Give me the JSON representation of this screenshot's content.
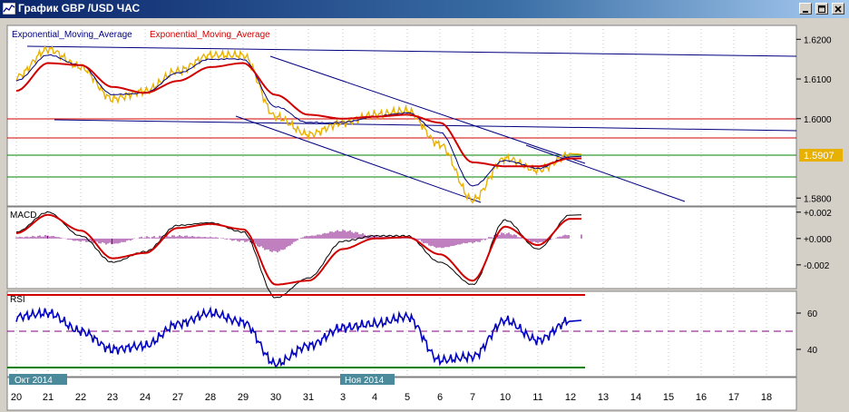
{
  "window": {
    "title": "График GBP /USD ЧАС",
    "buttons": [
      "minimize",
      "maximize",
      "close"
    ]
  },
  "colors": {
    "price": "#e8b000",
    "ema_fast": "#000080",
    "ema_slow": "#d00000",
    "resistance": "#d00000",
    "support": "#008000",
    "channel": "#000080",
    "macd_line": "#000000",
    "macd_signal": "#d00000",
    "macd_hist": "#800080",
    "rsi": "#0000c0",
    "rsi_upper": "#d00000",
    "rsi_lower": "#008000",
    "rsi_mid": "#800080",
    "grid": "#b0b0b0",
    "price_tag": "#e8b000"
  },
  "main_panel": {
    "legend_1": "Exponential_Moving_Average",
    "legend_2": "Exponential_Moving_Average",
    "y_ticks": [
      "1.6200",
      "1.6100",
      "1.6000",
      "1.5800"
    ],
    "last_price": "1.5907"
  },
  "macd_panel": {
    "label": "MACD",
    "y_ticks": [
      "+0.002",
      "+0.000",
      "-0.002"
    ]
  },
  "rsi_panel": {
    "label": "RSI",
    "y_ticks": [
      "60",
      "40"
    ]
  },
  "x_axis": {
    "month_labels": [
      "Окт 2014",
      "Ноя 2014"
    ],
    "ticks": [
      "20",
      "21",
      "22",
      "23",
      "24",
      "27",
      "28",
      "29",
      "30",
      "31",
      "3",
      "4",
      "5",
      "6",
      "7",
      "10",
      "11",
      "12",
      "13",
      "14",
      "15",
      "16",
      "17",
      "18"
    ]
  },
  "chart_data": [
    {
      "type": "line",
      "title": "",
      "x": [
        "20",
        "21",
        "22",
        "23",
        "24",
        "27",
        "28",
        "29",
        "30",
        "31",
        "3",
        "4",
        "5",
        "6",
        "7",
        "10",
        "11",
        "12"
      ],
      "series": [
        {
          "name": "Exponential_Moving_Average",
          "values": [
            1.6095,
            1.616,
            1.6135,
            1.606,
            1.6065,
            1.6115,
            1.615,
            1.615,
            1.603,
            1.599,
            1.599,
            1.6005,
            1.6015,
            1.5965,
            1.583,
            1.5895,
            1.5875,
            1.5905
          ]
        },
        {
          "name": "Exponential_Moving_Average",
          "values": [
            1.607,
            1.614,
            1.6135,
            1.608,
            1.6065,
            1.6095,
            1.613,
            1.614,
            1.606,
            1.601,
            1.6,
            1.6005,
            1.601,
            1.599,
            1.589,
            1.588,
            1.588,
            1.59
          ]
        },
        {
          "values": [
            1.6105,
            1.6175,
            1.613,
            1.605,
            1.607,
            1.612,
            1.616,
            1.616,
            1.6005,
            1.596,
            1.599,
            1.601,
            1.602,
            1.5935,
            1.5795,
            1.59,
            1.587,
            1.591
          ]
        }
      ],
      "ylim": [
        1.578,
        1.6235
      ]
    },
    {
      "type": "line",
      "title": "MACD",
      "x": [
        "20",
        "21",
        "22",
        "23",
        "24",
        "27",
        "28",
        "29",
        "30",
        "31",
        "3",
        "4",
        "5",
        "6",
        "7",
        "10",
        "11",
        "12"
      ],
      "series": [
        {
          "values": [
            0.0005,
            0.002,
            0.0002,
            -0.0018,
            -0.001,
            0.001,
            0.0012,
            0.0005,
            -0.0045,
            -0.003,
            -0.0002,
            0.0002,
            0.0002,
            -0.0018,
            -0.0035,
            0.0014,
            -0.0008,
            0.0018
          ]
        },
        {
          "values": [
            0.0004,
            0.0018,
            0.0006,
            -0.0015,
            -0.0011,
            0.0008,
            0.0011,
            0.0007,
            -0.0035,
            -0.0032,
            -0.0008,
            0.0,
            0.0001,
            -0.0012,
            -0.0032,
            0.0009,
            -0.0005,
            0.0015
          ]
        }
      ],
      "hist": [
        0.0001,
        0.0002,
        -0.0002,
        -0.0004,
        0.0001,
        0.0002,
        0.0001,
        -0.0002,
        -0.001,
        0.0002,
        0.0006,
        0.0002,
        0.0001,
        -0.0007,
        -0.0003,
        0.0004,
        -0.0003,
        0.0003
      ],
      "ylim": [
        -0.0038,
        0.0024
      ]
    },
    {
      "type": "line",
      "title": "RSI",
      "x": [
        "20",
        "21",
        "22",
        "23",
        "24",
        "27",
        "28",
        "29",
        "30",
        "31",
        "3",
        "4",
        "5",
        "6",
        "7",
        "10",
        "11",
        "12"
      ],
      "series": [
        {
          "values": [
            58,
            60,
            50,
            40,
            42,
            54,
            60,
            55,
            32,
            42,
            52,
            54,
            58,
            34,
            36,
            56,
            45,
            56
          ]
        }
      ],
      "levels": [
        70,
        50,
        30
      ],
      "ylim": [
        25,
        72
      ]
    }
  ]
}
